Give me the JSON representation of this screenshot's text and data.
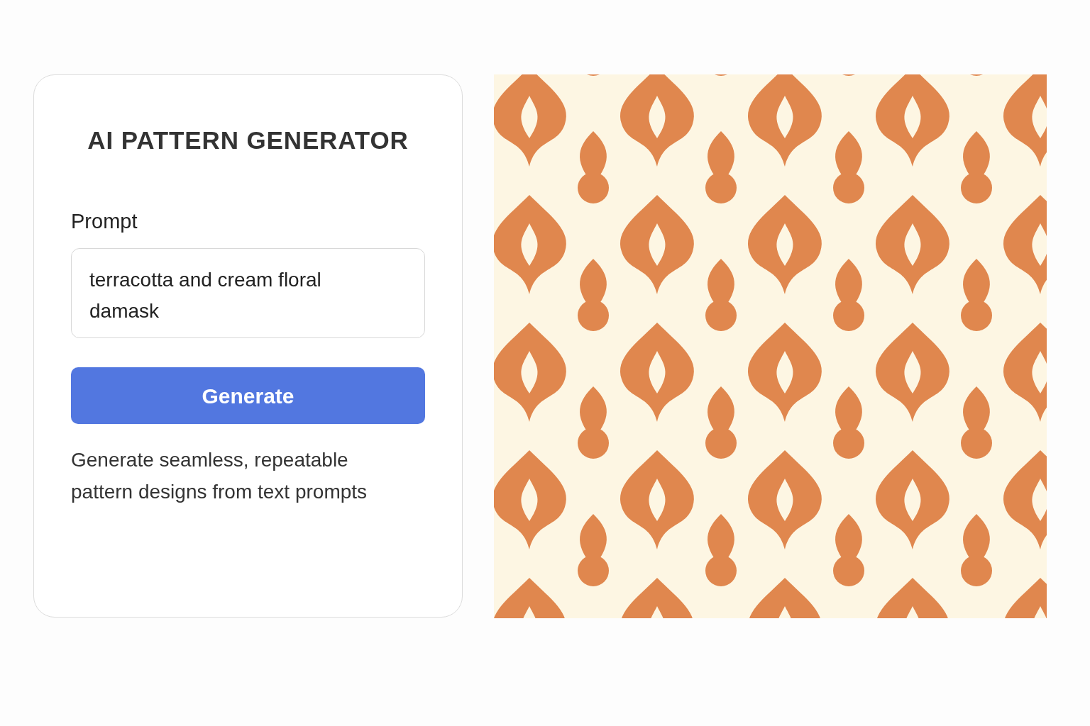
{
  "panel": {
    "title": "AI PATTERN GENERATOR",
    "prompt_label": "Prompt",
    "prompt_value": "terracotta and cream floral damask",
    "button": "Generate",
    "description": "Generate seamless, repeatable pattern designs from text prompts"
  }
}
